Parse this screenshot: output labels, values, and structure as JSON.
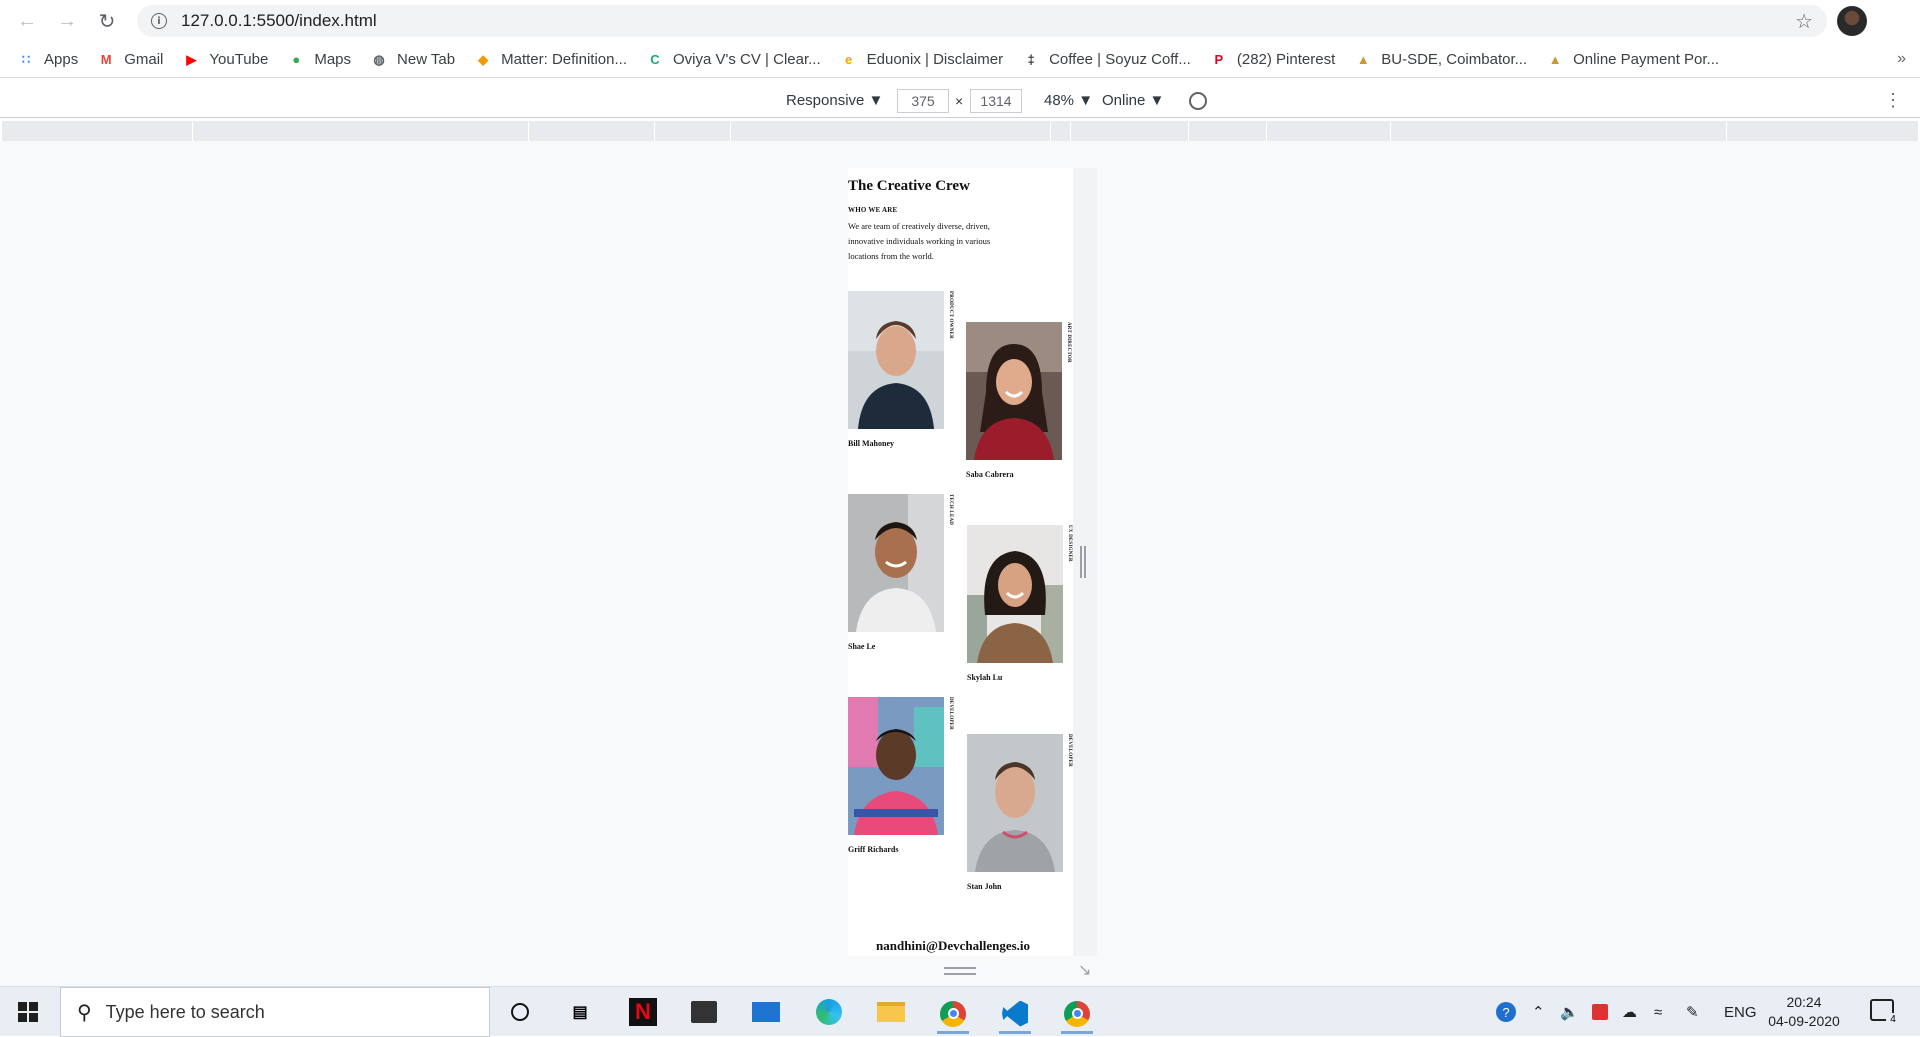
{
  "browser": {
    "url": "127.0.0.1:5500/index.html",
    "bookmarks": [
      {
        "label": "Apps",
        "icon": "apps-grid-icon",
        "color": "#4285f4"
      },
      {
        "label": "Gmail",
        "icon": "gmail-icon",
        "color": "#ea4335"
      },
      {
        "label": "YouTube",
        "icon": "youtube-icon",
        "color": "#ff0000"
      },
      {
        "label": "Maps",
        "icon": "maps-pin-icon",
        "color": "#34a853"
      },
      {
        "label": "New Tab",
        "icon": "globe-icon",
        "color": "#5f6368"
      },
      {
        "label": "Matter: Definition...",
        "icon": "matter-icon",
        "color": "#f29900"
      },
      {
        "label": "Oviya V's CV | Clear...",
        "icon": "clear-c-icon",
        "color": "#1fa67a"
      },
      {
        "label": "Eduonix | Disclaimer",
        "icon": "eduonix-icon",
        "color": "#f4a300"
      },
      {
        "label": "Coffee | Soyuz Coff...",
        "icon": "coffee-icon",
        "color": "#333333"
      },
      {
        "label": "(282) Pinterest",
        "icon": "pinterest-icon",
        "color": "#e60023"
      },
      {
        "label": "BU-SDE, Coimbator...",
        "icon": "person-icon",
        "color": "#c99a2e"
      },
      {
        "label": "Online Payment Por...",
        "icon": "person-icon",
        "color": "#c99a2e"
      }
    ],
    "more_bookmarks": "»"
  },
  "devtools": {
    "device": "Responsive ▼",
    "width": "375",
    "times": "×",
    "height": "1314",
    "zoom": "48% ▼",
    "network": "Online ▼"
  },
  "page": {
    "title": "The Creative Crew",
    "subtitle": "WHO WE ARE",
    "intro": "We are team of creatively diverse, driven, innovative individuals working in various locations from the world.",
    "members": [
      {
        "name": "Bill Mahoney",
        "role": "PRODUCT OWNER"
      },
      {
        "name": "Saba Cabrera",
        "role": "ART DIRECTOR"
      },
      {
        "name": "Shae Le",
        "role": "TECH LEAD"
      },
      {
        "name": "Skylah Lu",
        "role": "UX DESIGNER"
      },
      {
        "name": "Griff Richards",
        "role": "DEVELOPER"
      },
      {
        "name": "Stan John",
        "role": "DEVELOPER"
      }
    ],
    "email": "nandhini@Devchallenges.io"
  },
  "taskbar": {
    "search_placeholder": "Type here to search",
    "language": "ENG",
    "time": "20:24",
    "date": "04-09-2020",
    "notifications": "4"
  }
}
